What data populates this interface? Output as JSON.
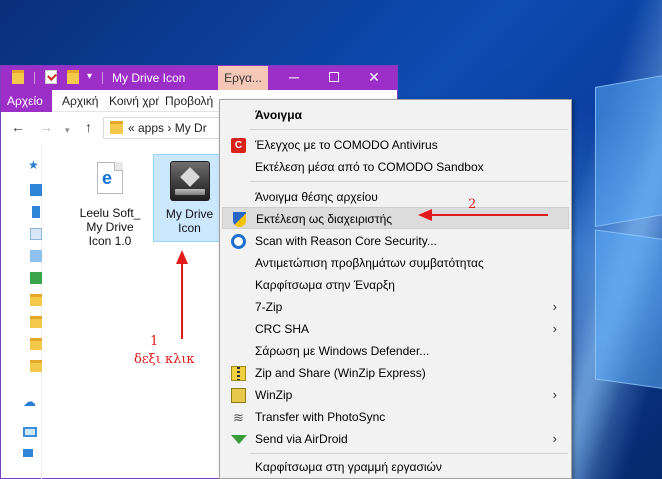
{
  "window": {
    "title": "My Drive Icon",
    "tools_tab": "Εργα...",
    "minimize": "─",
    "close": "✕"
  },
  "ribbon": {
    "file": "Αρχείο",
    "tabs": [
      "Αρχική",
      "Κοινή χρήση",
      "Προβολή"
    ]
  },
  "address": {
    "back": "←",
    "forward": "→",
    "dropdown": "▾",
    "up": "↑",
    "path": "«  apps  ›  My Dr"
  },
  "files": [
    {
      "name": "Leelu Soft_\nMy Drive\nIcon 1.0",
      "line1": "Leelu Soft_",
      "line2": "My Drive",
      "line3": "Icon 1.0"
    },
    {
      "name": "My Drive Icon",
      "line1": "My Drive",
      "line2": "Icon"
    }
  ],
  "annotations": {
    "step1_number": "1",
    "step1_text": "δεξι κλικ",
    "step2_number": "2"
  },
  "context_menu": {
    "items": [
      {
        "label": "Άνοιγμα",
        "bold": true
      },
      {
        "label": "Έλεγχος με το COMODO Antivirus",
        "icon": "comodo-icon"
      },
      {
        "label": "Εκτέλεση μέσα από το COMODO Sandbox"
      },
      {
        "label": "Άνοιγμα θέσης αρχείου"
      },
      {
        "label": "Εκτέλεση ως διαχειριστής",
        "icon": "uac-shield-icon",
        "highlighted": true
      },
      {
        "label": "Scan with Reason Core Security...",
        "icon": "reason-core-icon"
      },
      {
        "label": "Αντιμετώπιση προβλημάτων συμβατότητας"
      },
      {
        "label": "Καρφίτσωμα στην Έναρξη"
      },
      {
        "label": "7-Zip",
        "submenu": true
      },
      {
        "label": "CRC SHA",
        "submenu": true
      },
      {
        "label": "Σάρωση με Windows Defender..."
      },
      {
        "label": "Zip and Share (WinZip Express)",
        "icon": "zip-icon"
      },
      {
        "label": "WinZip",
        "icon": "winzip-icon",
        "submenu": true
      },
      {
        "label": "Transfer with PhotoSync",
        "icon": "photosync-icon"
      },
      {
        "label": "Send via AirDroid",
        "icon": "airdroid-icon",
        "submenu": true
      },
      {
        "label": "Καρφίτσωμα στη γραμμή εργασιών"
      }
    ],
    "submenu_glyph": "›"
  },
  "colors": {
    "titlebar": "#9c2fc8",
    "selection": "#cce8ff",
    "annotation": "#e11b1b"
  }
}
